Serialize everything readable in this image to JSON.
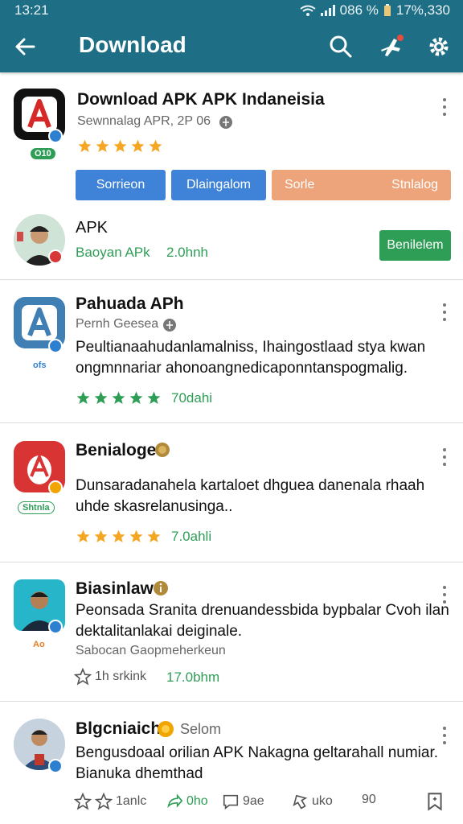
{
  "status_bar": {
    "time": "13:21",
    "battery_text": "086 %",
    "speed_text": "17%,330"
  },
  "app_bar": {
    "title": "Download",
    "icons": [
      "back-arrow-icon",
      "search-icon",
      "airplane-icon",
      "gear-icon"
    ]
  },
  "featured": {
    "name": "Download APK APK Indaneisia",
    "subtitle": "Sewnnalag APR, 2P 06",
    "tag": "O10",
    "rating_stars": 5,
    "buttons": [
      "Sorrieon",
      "Dlaingalom",
      "Sorle",
      "Stnlalog"
    ]
  },
  "apk_row": {
    "title": "APK",
    "subtitle": "Baoyan APk",
    "meta": "2.0hnh",
    "button": "Benilelem"
  },
  "posts": [
    {
      "name": "Pahuada APh",
      "subtitle": "Pernh Geesea",
      "tag": "ofs",
      "description": "Peultianaahudanlamalniss, Ihaingostlaad stya kwan ongmnnariar ahonoangnedicaponntanspogmalig.",
      "rating_stars": 5,
      "score": "70dahi"
    },
    {
      "name": "Benialoge",
      "tag": "Shtnla",
      "description": "Dunsaradanahela kartaloet dhguea danenala rhaah uhde skasrelanusinga..",
      "rating_stars": 5,
      "score": "7.0ahli"
    },
    {
      "name": "Biasinlaw",
      "tag": "Ao",
      "description": "Peonsada Sranita drenuandessbida bypbalar Cvoh ilan dektalitanlakai deiginale.",
      "subtitle": "Sabocan Gaopmeherkeun",
      "likes": "1h srkink",
      "score": "17.0bhm"
    },
    {
      "name": "Blgcniaich",
      "status": "Selom",
      "description": "Bengusdoaal  orilian APK Nakagna geltarahall numiar. Bianuka dhemthad",
      "actions": {
        "likes": "1anlc",
        "shares": "0ho",
        "comments": "9ae",
        "upvotes": "uko",
        "views": "90"
      }
    }
  ]
}
